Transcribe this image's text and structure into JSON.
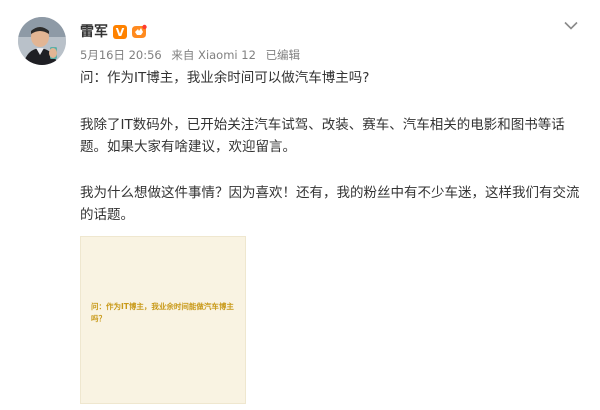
{
  "author": {
    "name": "雷军",
    "verified_badge": "V",
    "fan_badge_icon": "fan-group-icon",
    "avatar_icon": "avatar-photo"
  },
  "meta": {
    "time": "5月16日 20:56",
    "source": "来自 Xiaomi 12",
    "edited": "已编辑"
  },
  "menu": {
    "icon": "chevron-down-icon"
  },
  "post": {
    "paragraph1": "问：作为IT博主，我业余时间可以做汽车博主吗?",
    "paragraph2": "我除了IT数码外，已开始关注汽车试驾、改装、赛车、汽车相关的电影和图书等话题。如果大家有啥建议，欢迎留言。",
    "paragraph3": "我为什么想做这件事情？因为喜欢！还有，我的粉丝中有不少车迷，这样我们有交流的话题。"
  },
  "image": {
    "text": "问：作为IT博主，我业余时间能做汽车博主吗？"
  },
  "colors": {
    "accent": "#ff8200",
    "meta_text": "#808080",
    "image_bg": "#f9f3e2",
    "image_text": "#c99a1a"
  }
}
